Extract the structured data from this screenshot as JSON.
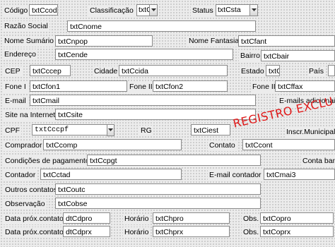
{
  "row1": {
    "codigo_label": "Código",
    "codigo_value": "txtCcod",
    "classificacao_label": "Classificação",
    "classificacao_value": "txtC",
    "status_label": "Status",
    "status_value": "txtCsta"
  },
  "razao": {
    "label": "Razão Social",
    "value": "txtCnome"
  },
  "nome_sumario": {
    "label": "Nome Sumário",
    "value": "txtCnpop"
  },
  "nome_fantasia": {
    "label": "Nome Fantasia",
    "value": "txtCfant"
  },
  "endereco": {
    "label": "Endereço",
    "value": "txtCende"
  },
  "bairro": {
    "label": "Bairro",
    "value": "txtCbair"
  },
  "cep": {
    "label": "CEP",
    "value": "txtCccep"
  },
  "cidade": {
    "label": "Cidade",
    "value": "txtCcida"
  },
  "estado": {
    "label": "Estado",
    "value": "txtC"
  },
  "pais": {
    "label": "País"
  },
  "fone1": {
    "label": "Fone I",
    "value": "txtCfon1"
  },
  "fone2": {
    "label": "Fone II",
    "value": "txtCfon2"
  },
  "fone3": {
    "label": "Fone III",
    "value": "txtCffax"
  },
  "email": {
    "label": "E-mail",
    "value": "txtCmail"
  },
  "emails_adicionais": {
    "label": "E-mails adicionais"
  },
  "site": {
    "label": "Site na Internet",
    "value": "txtCsite"
  },
  "cpf": {
    "label": "CPF",
    "value": "txtCccpf"
  },
  "rg": {
    "label": "RG"
  },
  "inscricao": {
    "value": "txtCiest",
    "label": "Inscr.Municipal"
  },
  "stamp": "REGISTRO EXCLU",
  "comprador": {
    "label": "Comprador",
    "value": "txtCcomp"
  },
  "contato": {
    "label": "Contato",
    "value": "txtCcont"
  },
  "condicoes": {
    "label": "Condições de pagamento",
    "value": "txtCcpgt"
  },
  "conta_banco": {
    "label": "Conta ban"
  },
  "contador": {
    "label": "Contador",
    "value": "txtCctad"
  },
  "email_contador": {
    "label": "E-mail contador",
    "value": "txtCmai3"
  },
  "outros": {
    "label": "Outros contatos",
    "value": "txtCoutc"
  },
  "observacao": {
    "label": "Observação",
    "value": "txtCobse"
  },
  "visit1": {
    "data_label": "Data próx.contato",
    "data_value": "dtCdpro",
    "horario_label": "Horário",
    "horario_value": "txtChpro",
    "obs_label": "Obs.",
    "obs_value": "txtCopro"
  },
  "visit2": {
    "data_label": "Data próx.contato",
    "data_value": "dtCdprx",
    "horario_label": "Horário",
    "horario_value": "txtChprx",
    "obs_label": "Obs.",
    "obs_value": "txtCoprx"
  }
}
